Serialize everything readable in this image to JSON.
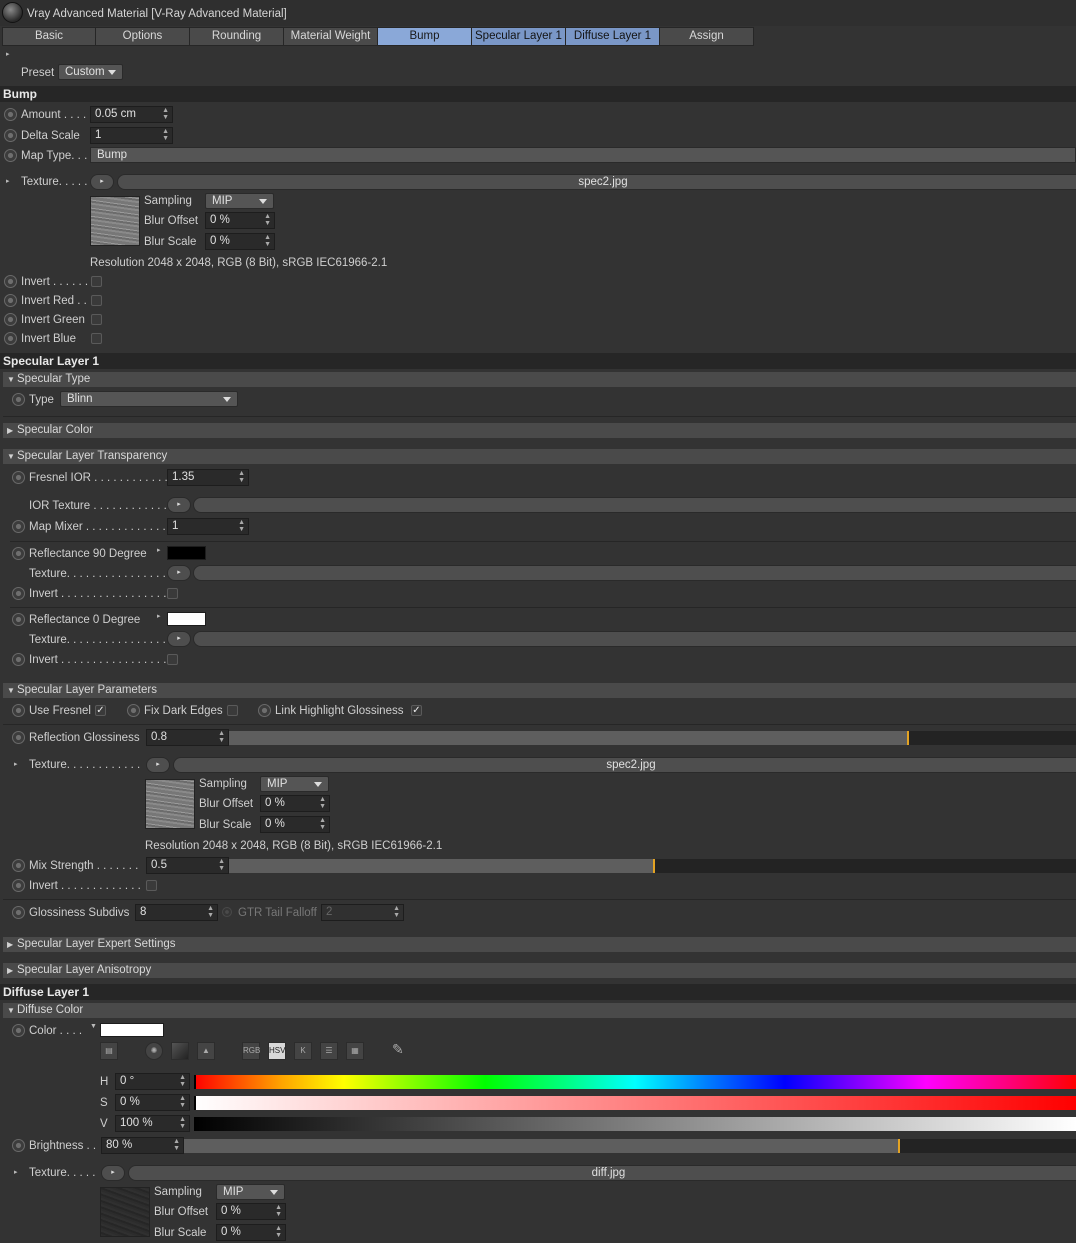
{
  "window": {
    "title": "Vray Advanced Material [V-Ray Advanced Material]"
  },
  "tabs": [
    {
      "label": "Basic"
    },
    {
      "label": "Options"
    },
    {
      "label": "Rounding"
    },
    {
      "label": "Material Weight"
    },
    {
      "label": "Bump"
    },
    {
      "label": "Specular Layer 1"
    },
    {
      "label": "Diffuse Layer 1"
    },
    {
      "label": "Assign"
    }
  ],
  "preset": {
    "label": "Preset",
    "value": "Custom"
  },
  "bump": {
    "header": "Bump",
    "amount": {
      "label": "Amount . . . .",
      "value": "0.05 cm"
    },
    "delta_scale": {
      "label": "Delta Scale",
      "value": "1"
    },
    "map_type": {
      "label": "Map Type. . .",
      "value": "Bump"
    },
    "texture": {
      "label": "Texture. . . . .",
      "file": "spec2.jpg",
      "sampling_label": "Sampling",
      "sampling": "MIP",
      "blur_offset_label": "Blur Offset",
      "blur_offset": "0 %",
      "blur_scale_label": "Blur Scale",
      "blur_scale": "0 %",
      "resolution": "Resolution 2048 x 2048, RGB (8 Bit), sRGB IEC61966-2.1"
    },
    "invert": "Invert . . . . . .",
    "invert_red": "Invert Red . .",
    "invert_green": "Invert Green",
    "invert_blue": "Invert Blue"
  },
  "specular": {
    "header": "Specular Layer 1",
    "type_group": "Specular Type",
    "type_label": "Type",
    "type_value": "Blinn",
    "color_group": "Specular Color",
    "transparency_group": "Specular Layer Transparency",
    "fresnel_ior": {
      "label": "Fresnel IOR . . . . . . . . . . . .",
      "value": "1.35"
    },
    "ior_texture": "IOR Texture . . . . . . . . . . . .",
    "map_mixer": {
      "label": "Map Mixer . . . . . . . . . . . . .",
      "value": "1"
    },
    "refl90": {
      "label": "Reflectance 90 Degree",
      "texture": "Texture. . . . . . . . . . . . . . . . .",
      "invert": "Invert . . . . . . . . . . . . . . . . . ."
    },
    "refl0": {
      "label": "Reflectance  0 Degree",
      "texture": "Texture. . . . . . . . . . . . . . . . .",
      "invert": "Invert . . . . . . . . . . . . . . . . . ."
    },
    "params_group": "Specular Layer Parameters",
    "use_fresnel": "Use Fresnel",
    "fix_dark_edges": "Fix Dark Edges",
    "link_highlight": "Link Highlight Glossiness",
    "refl_gloss": {
      "label": "Reflection Glossiness",
      "value": "0.8",
      "level": 0.8
    },
    "gloss_texture": {
      "label": "Texture. . . . . . . . . . . .",
      "file": "spec2.jpg",
      "sampling_label": "Sampling",
      "sampling": "MIP",
      "blur_offset_label": "Blur Offset",
      "blur_offset": "0 %",
      "blur_scale_label": "Blur Scale",
      "blur_scale": "0 %",
      "resolution": "Resolution 2048 x 2048, RGB (8 Bit), sRGB IEC61966-2.1"
    },
    "mix_strength": {
      "label": "Mix Strength . . . . . . .",
      "value": "0.5",
      "level": 0.5
    },
    "invert": "Invert . . . . . . . . . . . . .",
    "gloss_subdivs": {
      "label": "Glossiness Subdivs",
      "value": "8"
    },
    "gtr": {
      "label": "GTR Tail Falloff",
      "value": "2"
    },
    "expert_group": "Specular Layer Expert Settings",
    "aniso_group": "Specular Layer Anisotropy"
  },
  "diffuse": {
    "header": "Diffuse Layer 1",
    "color_group": "Diffuse Color",
    "color_label": "Color . . . .",
    "swatch": "#ffffff",
    "mode_buttons": [
      {
        "label": "RGB"
      },
      {
        "label": "HSV"
      },
      {
        "label": "K"
      }
    ],
    "h": {
      "label": "H",
      "value": "0 °"
    },
    "s": {
      "label": "S",
      "value": "0 %"
    },
    "v": {
      "label": "V",
      "value": "100 %"
    },
    "brightness": {
      "label": "Brightness . .",
      "value": "80 %",
      "level": 0.8
    },
    "texture": {
      "label": "Texture. . . . .",
      "file": "diff.jpg",
      "sampling_label": "Sampling",
      "sampling": "MIP",
      "blur_offset_label": "Blur Offset",
      "blur_offset": "0 %",
      "blur_scale_label": "Blur Scale",
      "blur_scale": "0 %"
    }
  },
  "colors": {
    "active_tab": "#8aa8d8",
    "slider_mark": "#e3a323",
    "panel_bg": "#333333"
  }
}
